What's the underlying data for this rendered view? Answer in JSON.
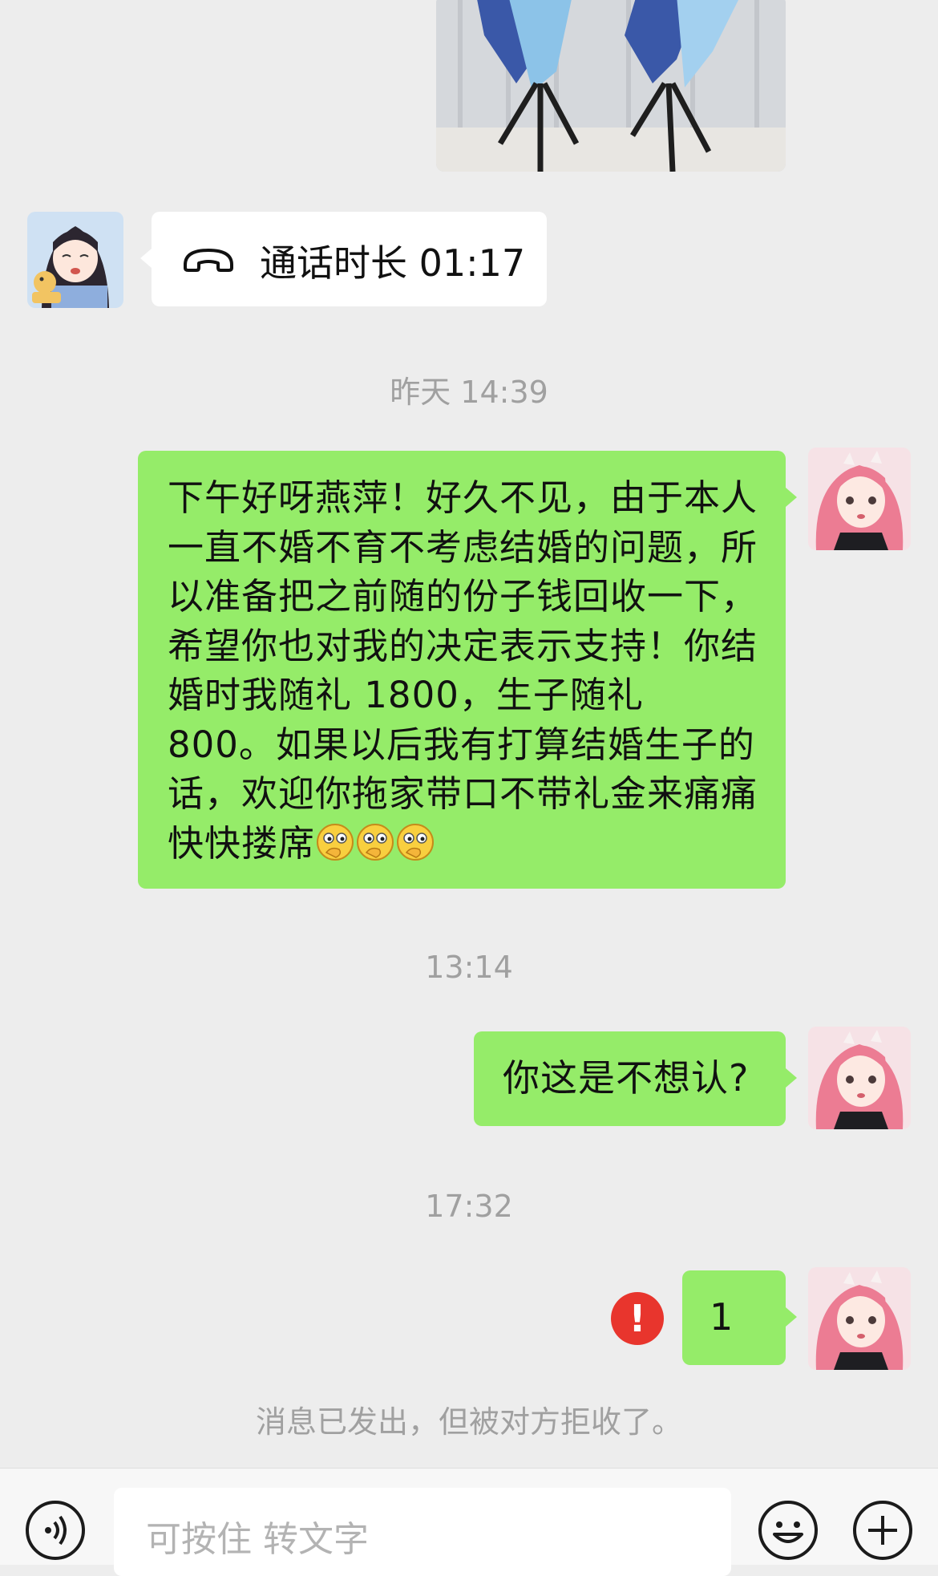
{
  "messages": {
    "call": {
      "label": "通话时长 01:17"
    },
    "timestamp_1": "昨天 14:39",
    "message_1": "下午好呀燕萍！好久不见，由于本人一直不婚不育不考虑结婚的问题，所以准备把之前随的份子钱回收一下，希望你也对我的决定表示支持！你结婚时我随礼 1800，生子随礼 800。如果以后我有打算结婚生子的话，欢迎你拖家带口不带礼金来痛痛快快搂席",
    "emoji_count": 3,
    "timestamp_2": "13:14",
    "message_2": "你这是不想认?",
    "timestamp_3": "17:32",
    "message_3": "1",
    "error_mark": "!",
    "rejected_notice": "消息已发出，但被对方拒收了。"
  },
  "input_bar": {
    "placeholder": "可按住 转文字"
  },
  "icons": {
    "call": "phone-hangup-icon",
    "voice": "voice-icon",
    "emoji": "emoji-icon",
    "add": "plus-icon",
    "error": "error-icon"
  },
  "colors": {
    "background": "#ededed",
    "sent_bubble": "#95ec69",
    "received_bubble": "#ffffff",
    "error": "#e8352d",
    "timestamp_text": "#a0a0a0"
  }
}
